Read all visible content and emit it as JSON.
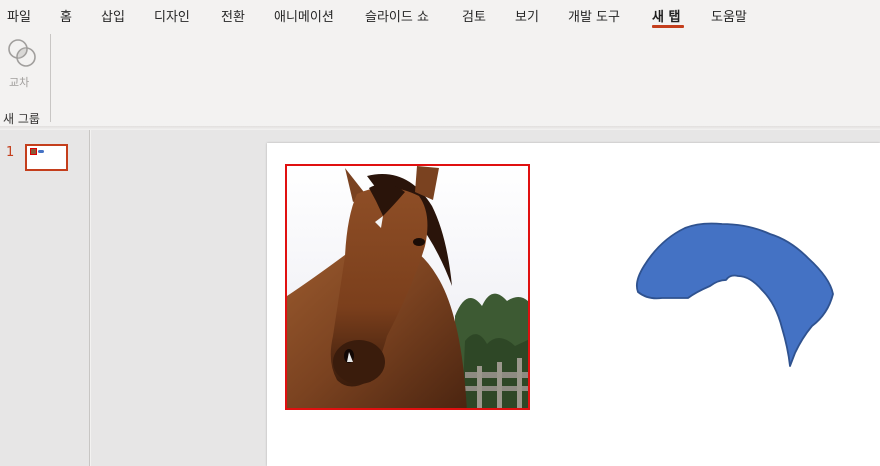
{
  "menu": {
    "tabs": [
      {
        "label": "파일"
      },
      {
        "label": "홈"
      },
      {
        "label": "삽입"
      },
      {
        "label": "디자인"
      },
      {
        "label": "전환"
      },
      {
        "label": "애니메이션"
      },
      {
        "label": "슬라이드 쇼"
      },
      {
        "label": "검토"
      },
      {
        "label": "보기"
      },
      {
        "label": "개발 도구"
      },
      {
        "label": "새 탭"
      },
      {
        "label": "도움말"
      }
    ],
    "active_tab": "새 탭"
  },
  "ribbon": {
    "intersect_label": "교차",
    "group_label": "새 그룹"
  },
  "thumbnails": [
    {
      "number": "1"
    }
  ],
  "colors": {
    "accent": "#c43e1c",
    "shape_fill": "#4472c4",
    "shape_outline": "#2f528f",
    "selection": "#e01010"
  },
  "icons": {
    "intersect": "intersect-shapes-icon"
  }
}
